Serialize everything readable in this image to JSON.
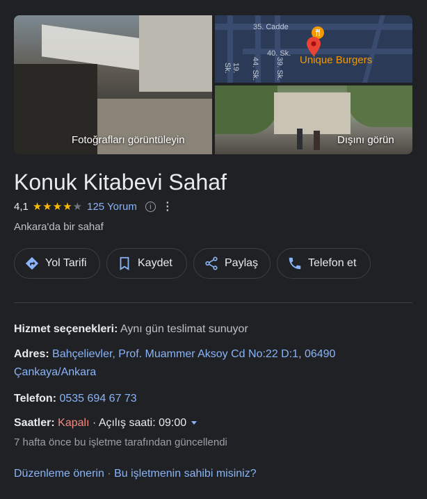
{
  "photos": {
    "main_label": "Fotoğrafları görüntüleyin",
    "outside_label": "Dışını görün",
    "map": {
      "streets": [
        "35. Cadde",
        "40. Sk.",
        "44. Sk.",
        "39. Sk.",
        "19. Sk."
      ],
      "place_label": "Unique Burgers"
    }
  },
  "business": {
    "name": "Konuk Kitabevi Sahaf",
    "rating": "4,1",
    "stars_filled": 4,
    "stars_total": 5,
    "reviews_label": "125 Yorum",
    "category": "Ankara'da bir sahaf"
  },
  "actions": {
    "directions": "Yol Tarifi",
    "save": "Kaydet",
    "share": "Paylaş",
    "call": "Telefon et"
  },
  "details": {
    "service_label": "Hizmet seçenekleri:",
    "service_value": "Aynı gün teslimat sunuyor",
    "address_label": "Adres:",
    "address_line1": "Bahçelievler, Prof. Muammer Aksoy Cd No:22 D:1, 06490",
    "address_line2": "Çankaya/Ankara",
    "phone_label": "Telefon:",
    "phone_value": "0535 694 67 73",
    "hours_label": "Saatler:",
    "hours_status": "Kapalı",
    "hours_sep": " · ",
    "hours_open": "Açılış saati: 09:00",
    "updated_note": "7 hafta önce bu işletme tarafından güncellendi"
  },
  "footer": {
    "suggest_edit": "Düzenleme önerin",
    "sep": " · ",
    "own_business": "Bu işletmenin sahibi misiniz?"
  },
  "colors": {
    "background": "#202124",
    "link": "#8ab4f8",
    "star": "#fbbc04",
    "closed": "#f28b82",
    "map_pin": "#ea4335",
    "map_place": "#f29900"
  }
}
